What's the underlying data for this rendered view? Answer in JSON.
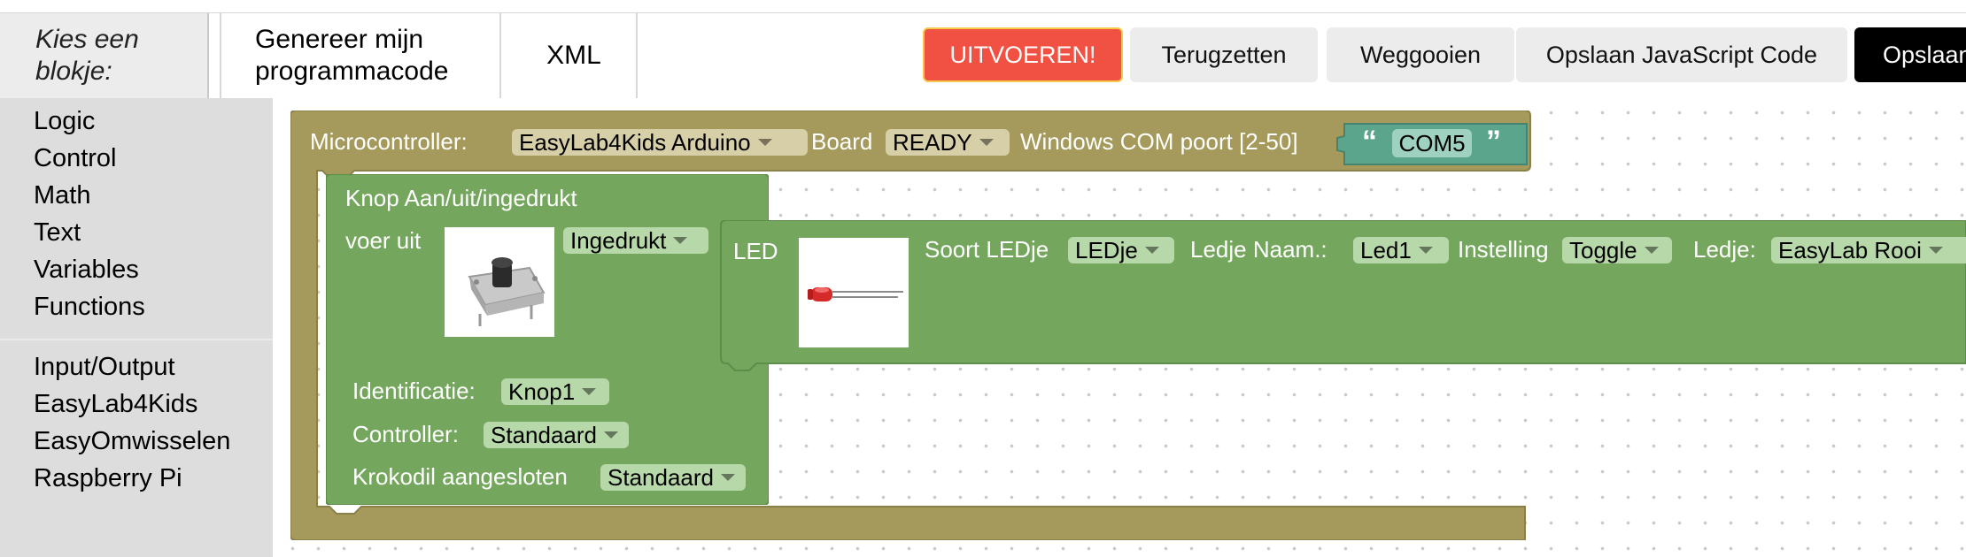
{
  "header": {
    "blocks_tab": "Kies een blokje:",
    "code_tab": "Genereer mijn programmacode",
    "xml_tab": "XML",
    "run_label": "UITVOEREN!",
    "reset_label": "Terugzetten",
    "discard_label": "Weggooien",
    "save_js_label": "Opslaan JavaScript Code",
    "save_label": "Opslaan"
  },
  "toolbox": {
    "group1": [
      "Logic",
      "Control",
      "Math",
      "Text",
      "Variables",
      "Functions"
    ],
    "group2": [
      "Input/Output",
      "EasyLab4Kids",
      "EasyOmwisselen",
      "Raspberry Pi"
    ]
  },
  "workspace": {
    "micro": {
      "label": "Microcontroller:",
      "board_value": "EasyLab4Kids Arduino",
      "board_label": "Board",
      "status_value": "READY",
      "port_label": "Windows COM poort [2-50]",
      "port_value": "COM5",
      "quote_open": "“",
      "quote_close": "”"
    },
    "button_block": {
      "title": "Knop Aan/uit/ingedrukt",
      "do_label": "voer uit",
      "state_value": "Ingedrukt",
      "id_label": "Identificatie:",
      "id_value": "Knop1",
      "controller_label": "Controller:",
      "controller_value": "Standaard",
      "clip_label": "Krokodil aangesloten",
      "clip_value": "Standaard"
    },
    "led_block": {
      "title": "LED",
      "type_label": "Soort LEDje",
      "type_value": "LEDje",
      "name_label": "Ledje Naam.:",
      "name_value": "Led1",
      "setting_label": "Instelling",
      "setting_value": "Toggle",
      "led_label": "Ledje:",
      "led_value": "EasyLab Rooi"
    }
  },
  "colors": {
    "micro_block": "#a59a5b",
    "green_block": "#74a75d",
    "text_block": "#5ba58c",
    "run_button": "#f05142"
  }
}
